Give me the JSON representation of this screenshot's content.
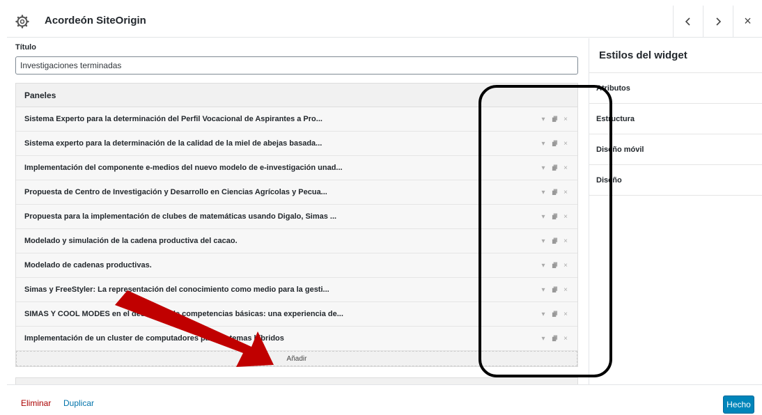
{
  "header": {
    "title": "Acordeón SiteOrigin",
    "icons": {
      "settings": "gear-icon",
      "prev": "chevron-left-icon",
      "next": "chevron-right-icon",
      "close": "close-icon"
    },
    "close_label": "×"
  },
  "form": {
    "title_label": "Título",
    "title_value": "Investigaciones terminadas",
    "panels_label": "Paneles",
    "panels": [
      {
        "title": "Sistema Experto para la determinación del Perfil Vocacional de Aspirantes a Pro..."
      },
      {
        "title": "Sistema experto para la determinación de la calidad de la miel de abejas basada..."
      },
      {
        "title": "Implementación del componente e-medios del nuevo modelo de e-investigación unad..."
      },
      {
        "title": "Propuesta de Centro de Investigación y Desarrollo en Ciencias Agrícolas y Pecua..."
      },
      {
        "title": "Propuesta para la implementación de clubes de matemáticas usando Digalo, Simas ..."
      },
      {
        "title": "Modelado y simulación de la cadena productiva del cacao."
      },
      {
        "title": "Modelado de cadenas productivas."
      },
      {
        "title": "Simas y FreeStyler: La representación del conocimiento como medio para la gesti..."
      },
      {
        "title": "SIMAS Y COOL MODES en el desarrollo de competencias básicas: una experiencia de..."
      },
      {
        "title": "Implementación de un cluster de computadores para sistemas híbridos"
      }
    ],
    "add_label": "Añadir",
    "row_action_icons": [
      "expand-icon",
      "duplicate-icon",
      "delete-icon"
    ],
    "delete_glyph": "×",
    "expand_glyph": "▾"
  },
  "sidebar": {
    "heading": "Estilos del widget",
    "items": [
      "Atributos",
      "Estructura",
      "Diseño móvil",
      "Diseño"
    ]
  },
  "footer": {
    "delete_label": "Eliminar",
    "duplicate_label": "Duplicar",
    "done_label": "Hecho"
  },
  "colors": {
    "accent": "#0085ba",
    "delete_link": "#aa0000",
    "duplicate_link": "#0073aa",
    "annotation_arrow": "#c00000",
    "annotation_box": "#000000"
  }
}
